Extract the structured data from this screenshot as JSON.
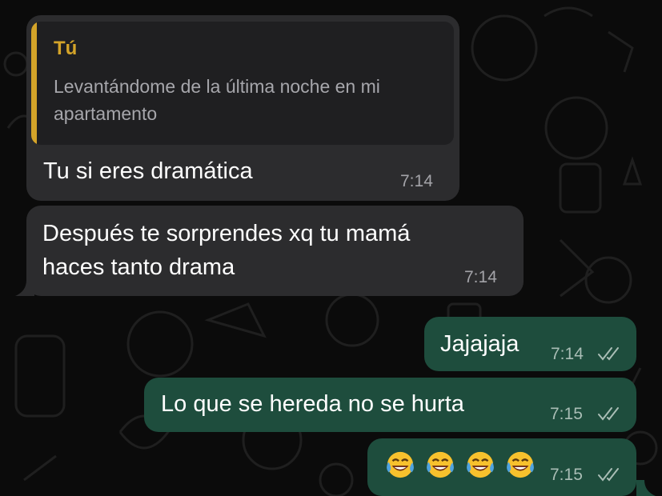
{
  "messages": [
    {
      "direction": "incoming",
      "reply_to": {
        "author": "Tú",
        "text": "Levantándome de la última noche en mi apartamento"
      },
      "text": "Tu si eres dramática",
      "time": "7:14"
    },
    {
      "direction": "incoming",
      "lines": [
        "Después te sorprendes xq tu mamá",
        "haces tanto drama"
      ],
      "time": "7:14"
    },
    {
      "direction": "outgoing",
      "text": "Jajajaja",
      "time": "7:14",
      "status": "read"
    },
    {
      "direction": "outgoing",
      "text": "Lo que se hereda no se hurta",
      "time": "7:15",
      "status": "read"
    },
    {
      "direction": "outgoing",
      "text": "😂😂😂😂",
      "emoji_icons": [
        "face-with-tears-of-joy-icon",
        "face-with-tears-of-joy-icon",
        "face-with-tears-of-joy-icon",
        "face-with-tears-of-joy-icon"
      ],
      "time": "7:15",
      "status": "read"
    }
  ],
  "colors": {
    "background": "#0b0b0b",
    "incoming_bubble": "#2c2c2e",
    "outgoing_bubble": "#1e4d3d",
    "quote_accent": "#d4a429"
  }
}
